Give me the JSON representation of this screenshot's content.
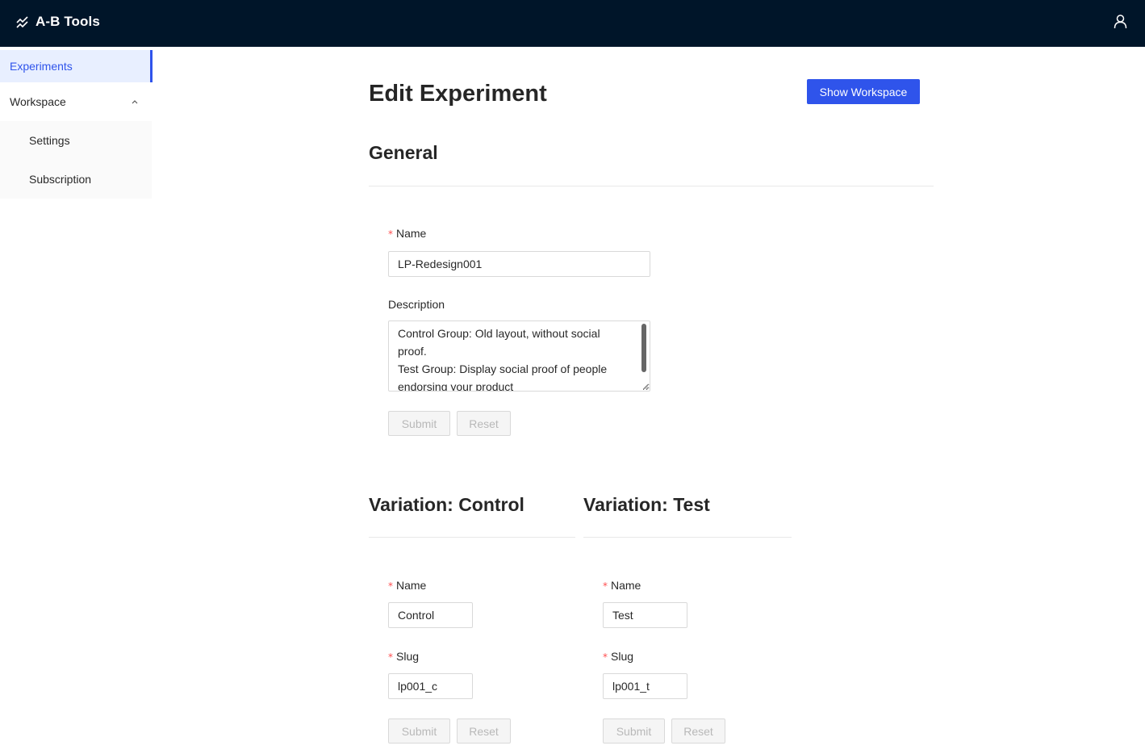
{
  "header": {
    "app_title": "A-B Tools",
    "logo_icon": "line-chart-icon",
    "user_icon": "user-icon"
  },
  "sidebar": {
    "items": [
      {
        "label": "Experiments",
        "active": true
      },
      {
        "label": "Workspace",
        "expanded": true,
        "icon": "chevron-up-icon",
        "children": [
          {
            "label": "Settings"
          },
          {
            "label": "Subscription"
          }
        ]
      }
    ]
  },
  "page": {
    "title": "Edit Experiment",
    "show_workspace_label": "Show Workspace"
  },
  "general": {
    "title": "General",
    "name_label": "Name",
    "name_value": "LP-Redesign001",
    "description_label": "Description",
    "description_value": "Control Group: Old layout, without social proof.\nTest Group: Display social proof of people endorsing your product",
    "submit_label": "Submit",
    "reset_label": "Reset"
  },
  "variations": [
    {
      "title": "Variation: Control",
      "name_label": "Name",
      "name_value": "Control",
      "slug_label": "Slug",
      "slug_value": "lp001_c",
      "submit_label": "Submit",
      "reset_label": "Reset"
    },
    {
      "title": "Variation: Test",
      "name_label": "Name",
      "name_value": "Test",
      "slug_label": "Slug",
      "slug_value": "lp001_t",
      "submit_label": "Submit",
      "reset_label": "Reset"
    }
  ],
  "colors": {
    "header_bg": "#001529",
    "primary": "#2f54eb",
    "required": "#ff4d4f",
    "active_menu_bg": "#e8efff"
  }
}
